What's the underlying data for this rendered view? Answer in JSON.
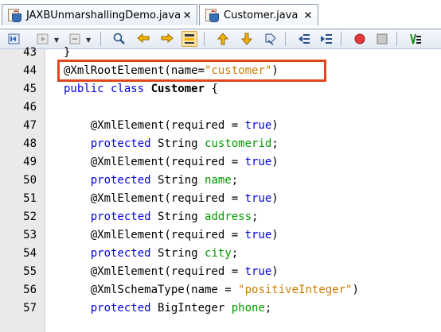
{
  "tabs": [
    {
      "label": "JAXBUnmarshallingDemo.java",
      "close": "×",
      "icon": "java-file-icon",
      "active": false
    },
    {
      "label": "Customer.java",
      "close": "×",
      "icon": "java-file-icon",
      "active": true
    }
  ],
  "toolbar": {
    "buttons": [
      "back-icon",
      "forward-icon",
      "last-edit-icon",
      "find-icon",
      "find-previous-icon",
      "find-next-icon",
      "toggle-highlight-icon",
      "previous-bookmark-icon",
      "next-bookmark-icon",
      "toggle-bookmark-icon",
      "shift-left-icon",
      "shift-right-icon",
      "start-macro-icon",
      "stop-macro-icon",
      "comment-icon"
    ]
  },
  "editor": {
    "lines": [
      {
        "n": "43",
        "tokens": [
          {
            "t": "}",
            "c": "ann"
          }
        ]
      },
      {
        "n": "44",
        "tokens": [
          {
            "t": "@XmlRootElement(name=",
            "c": "ann"
          },
          {
            "t": "\"customer\"",
            "c": "str"
          },
          {
            "t": ")",
            "c": "ann"
          }
        ]
      },
      {
        "n": "45",
        "tokens": [
          {
            "t": "public class ",
            "c": "kw"
          },
          {
            "t": "Customer",
            "c": "ty bold"
          },
          {
            "t": " {",
            "c": "ann"
          }
        ]
      },
      {
        "n": "46",
        "tokens": []
      },
      {
        "n": "47",
        "tokens": [
          {
            "t": "    @XmlElement(required = ",
            "c": "ann"
          },
          {
            "t": "true",
            "c": "kw"
          },
          {
            "t": ")",
            "c": "ann"
          }
        ]
      },
      {
        "n": "48",
        "tokens": [
          {
            "t": "    protected ",
            "c": "kw"
          },
          {
            "t": "String ",
            "c": "ty"
          },
          {
            "t": "customerid",
            "c": "field"
          },
          {
            "t": ";",
            "c": "ann"
          }
        ]
      },
      {
        "n": "49",
        "tokens": [
          {
            "t": "    @XmlElement(required = ",
            "c": "ann"
          },
          {
            "t": "true",
            "c": "kw"
          },
          {
            "t": ")",
            "c": "ann"
          }
        ]
      },
      {
        "n": "50",
        "tokens": [
          {
            "t": "    protected ",
            "c": "kw"
          },
          {
            "t": "String ",
            "c": "ty"
          },
          {
            "t": "name",
            "c": "field"
          },
          {
            "t": ";",
            "c": "ann"
          }
        ]
      },
      {
        "n": "51",
        "tokens": [
          {
            "t": "    @XmlElement(required = ",
            "c": "ann"
          },
          {
            "t": "true",
            "c": "kw"
          },
          {
            "t": ")",
            "c": "ann"
          }
        ]
      },
      {
        "n": "52",
        "tokens": [
          {
            "t": "    protected ",
            "c": "kw"
          },
          {
            "t": "String ",
            "c": "ty"
          },
          {
            "t": "address",
            "c": "field"
          },
          {
            "t": ";",
            "c": "ann"
          }
        ]
      },
      {
        "n": "53",
        "tokens": [
          {
            "t": "    @XmlElement(required = ",
            "c": "ann"
          },
          {
            "t": "true",
            "c": "kw"
          },
          {
            "t": ")",
            "c": "ann"
          }
        ]
      },
      {
        "n": "54",
        "tokens": [
          {
            "t": "    protected ",
            "c": "kw"
          },
          {
            "t": "String ",
            "c": "ty"
          },
          {
            "t": "city",
            "c": "field"
          },
          {
            "t": ";",
            "c": "ann"
          }
        ]
      },
      {
        "n": "55",
        "tokens": [
          {
            "t": "    @XmlElement(required = ",
            "c": "ann"
          },
          {
            "t": "true",
            "c": "kw"
          },
          {
            "t": ")",
            "c": "ann"
          }
        ]
      },
      {
        "n": "56",
        "tokens": [
          {
            "t": "    @XmlSchemaType(name = ",
            "c": "ann"
          },
          {
            "t": "\"positiveInteger\"",
            "c": "str"
          },
          {
            "t": ")",
            "c": "ann"
          }
        ]
      },
      {
        "n": "57",
        "tokens": [
          {
            "t": "    protected ",
            "c": "kw"
          },
          {
            "t": "BigInteger ",
            "c": "ty"
          },
          {
            "t": "phone",
            "c": "field"
          },
          {
            "t": ";",
            "c": "ann"
          }
        ]
      }
    ]
  },
  "colors": {
    "keyword": "#0000e6",
    "field": "#009900",
    "string": "#ce7b00",
    "highlight_box": "#e0461c"
  }
}
